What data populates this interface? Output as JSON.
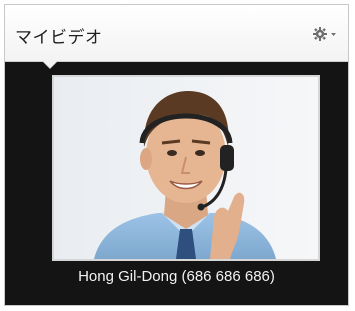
{
  "panel": {
    "title": "マイビデオ",
    "settings_icon": "gear-icon",
    "dropdown_icon": "chevron-down-icon"
  },
  "video": {
    "caption": "Hong Gil-Dong (686 686 686)"
  },
  "colors": {
    "panel_background": "#141414",
    "header_background": "#f3f3f3",
    "caption_text": "#f2f2f2"
  }
}
